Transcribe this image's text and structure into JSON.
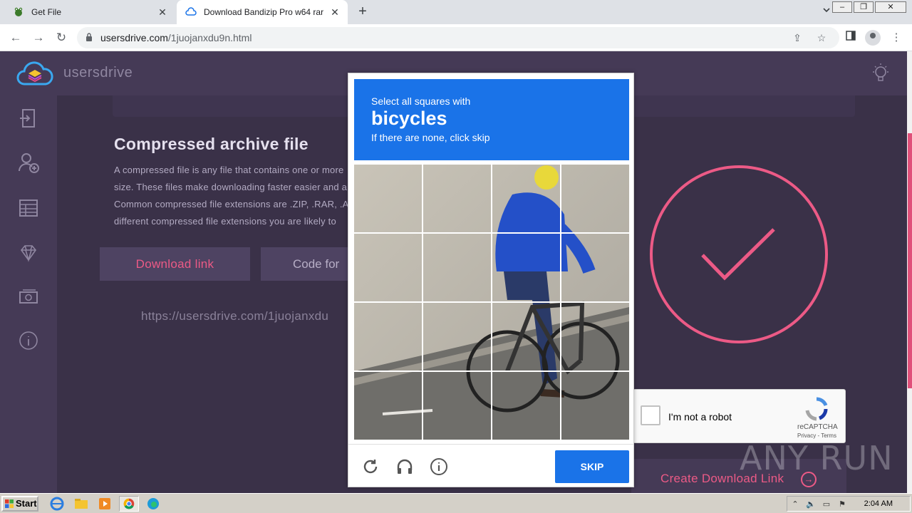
{
  "browser": {
    "tabs": [
      {
        "title": "Get File",
        "close": "✕"
      },
      {
        "title": "Download Bandizip Pro w64 rar",
        "close": "✕"
      }
    ],
    "new_tab": "+",
    "url_domain": "usersdrive.com",
    "url_path": "/1juojanxdu9n.html"
  },
  "site": {
    "brand": "usersdrive",
    "section_title": "Compressed archive file",
    "paragraph_lines": [
      "A compressed file is any file that contains one or more",
      "size. These files make downloading faster easier and al",
      "Common compressed file extensions are .ZIP, .RAR, .AR",
      "different compressed file extensions you are likely to"
    ],
    "download_link_btn": "Download link",
    "code_btn": "Code for",
    "link_url": "https://usersdrive.com/1juojanxdu",
    "create_btn": "Create Download Link",
    "accent_color": "#ec5a86"
  },
  "recaptcha": {
    "label": "I'm not a robot",
    "brand": "reCAPTCHA",
    "terms": "Privacy - Terms"
  },
  "captcha": {
    "line1": "Select all squares with",
    "target": "bicycles",
    "line3": "If there are none, click skip",
    "skip": "SKIP",
    "header_color": "#1a73e8"
  },
  "watermark": "ANY RUN",
  "taskbar": {
    "start": "Start",
    "clock": "2:04 AM"
  }
}
